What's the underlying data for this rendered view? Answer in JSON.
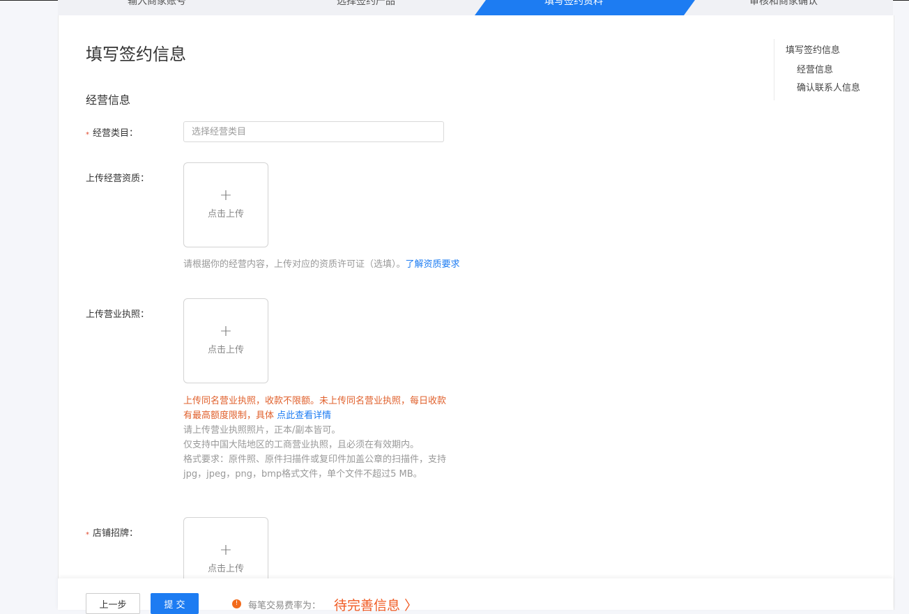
{
  "steps": [
    {
      "label": "输入商家账号"
    },
    {
      "label": "选择签约产品"
    },
    {
      "label": "填写签约资料"
    },
    {
      "label": "审核和商家确认"
    }
  ],
  "page": {
    "title": "填写签约信息",
    "section_title": "经营信息"
  },
  "anchor_nav": {
    "main": "填写签约信息",
    "items": [
      "经营信息",
      "确认联系人信息"
    ]
  },
  "form": {
    "required_mark": "*",
    "category": {
      "label": "经营类目：",
      "placeholder": "选择经营类目",
      "value": ""
    },
    "qualification": {
      "label": "上传经营资质：",
      "upload_plus": "+",
      "upload_text": "点击上传",
      "hint": "请根据你的经营内容，上传对应的资质许可证（选填）。",
      "hint_link": "了解资质要求"
    },
    "license": {
      "label": "上传营业执照：",
      "upload_plus": "+",
      "upload_text": "点击上传",
      "warn": "上传同名营业执照，收款不限额。未上传同名营业执照，每日收款有最高额度限制，具体",
      "warn_link": "点此查看详情",
      "lines": [
        "请上传营业执照照片，正本/副本皆可。",
        "仅支持中国大陆地区的工商营业执照，且必须在有效期内。",
        "格式要求：原件照、原件扫描件或复印件加盖公章的扫描件，支持jpg，jpeg，png，bmp格式文件，单个文件不超过5 MB。"
      ]
    },
    "storefront": {
      "label": "店铺招牌：",
      "upload_plus": "+",
      "upload_text": "点击上传"
    }
  },
  "footer": {
    "prev_label": "上一步",
    "submit_label": "提 交",
    "fee_icon": "!",
    "fee_label": "每笔交易费率为：",
    "fee_status": "待完善信息 〉"
  },
  "colors": {
    "primary": "#1d7cf2",
    "warn": "#e0602c",
    "fee_status": "#f05a22",
    "required": "#e04a2f"
  }
}
